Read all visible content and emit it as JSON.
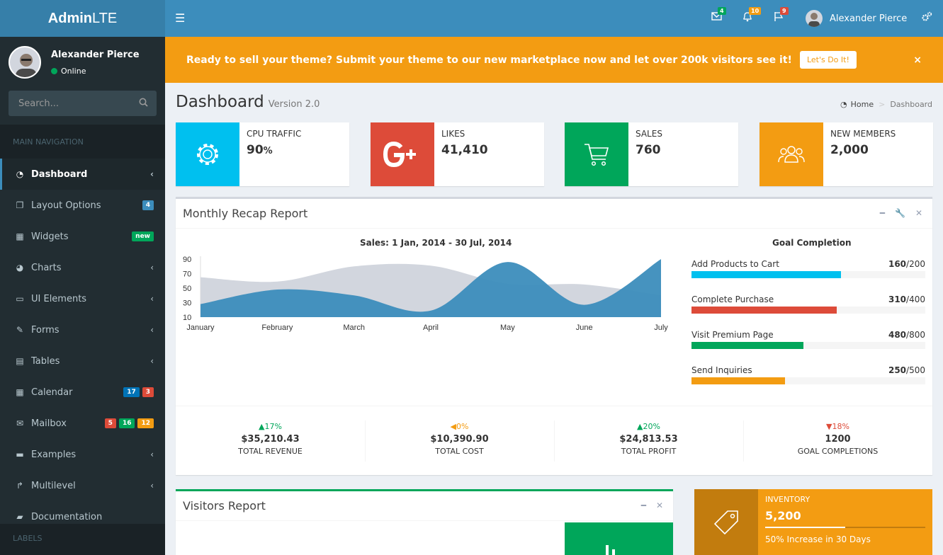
{
  "brand": {
    "name_bold": "Admin",
    "name_rest": "LTE"
  },
  "user": {
    "name": "Alexander Pierce",
    "status": "Online"
  },
  "search": {
    "placeholder": "Search..."
  },
  "sidebar": {
    "header": "MAIN NAVIGATION",
    "labels_header": "LABELS",
    "items": [
      {
        "label": "Dashboard",
        "icon": "dashboard-icon"
      },
      {
        "label": "Layout Options",
        "icon": "files-icon",
        "badges": [
          "4"
        ]
      },
      {
        "label": "Widgets",
        "icon": "grid-icon",
        "badges": [
          "new"
        ]
      },
      {
        "label": "Charts",
        "icon": "pie-chart-icon"
      },
      {
        "label": "UI Elements",
        "icon": "laptop-icon"
      },
      {
        "label": "Forms",
        "icon": "edit-icon"
      },
      {
        "label": "Tables",
        "icon": "table-icon"
      },
      {
        "label": "Calendar",
        "icon": "calendar-icon",
        "badges": [
          "17",
          "3"
        ]
      },
      {
        "label": "Mailbox",
        "icon": "envelope-icon",
        "badges": [
          "5",
          "16",
          "12"
        ]
      },
      {
        "label": "Examples",
        "icon": "folder-icon"
      },
      {
        "label": "Multilevel",
        "icon": "share-icon"
      },
      {
        "label": "Documentation",
        "icon": "book-icon"
      }
    ]
  },
  "topbar": {
    "messages_count": "4",
    "notifications_count": "10",
    "tasks_count": "9",
    "user_name": "Alexander Pierce"
  },
  "banner": {
    "text": "Ready to sell your theme? Submit your theme to our new marketplace now and let over 200k visitors see it!",
    "button": "Let's Do It!",
    "close": "×"
  },
  "page": {
    "title": "Dashboard",
    "subtitle": "Version 2.0"
  },
  "breadcrumb": {
    "home": "Home",
    "current": "Dashboard"
  },
  "info_boxes": [
    {
      "label": "CPU TRAFFIC",
      "value": "90",
      "unit": "%",
      "color": "#00c0ef",
      "icon": "gear-icon"
    },
    {
      "label": "LIKES",
      "value": "41,410",
      "color": "#dd4b39",
      "icon": "google-plus-icon"
    },
    {
      "label": "SALES",
      "value": "760",
      "color": "#00a65a",
      "icon": "shopping-cart-icon"
    },
    {
      "label": "NEW MEMBERS",
      "value": "2,000",
      "color": "#f39c12",
      "icon": "users-icon"
    }
  ],
  "recap": {
    "title": "Monthly Recap Report",
    "goal_title": "Goal Completion",
    "goals": [
      {
        "label": "Add Products to Cart",
        "done": "160",
        "total": "/200",
        "fraction": 0.8,
        "color": "#00c0ef"
      },
      {
        "label": "Complete Purchase",
        "done": "310",
        "total": "/400",
        "fraction": 0.775,
        "color": "#dd4b39"
      },
      {
        "label": "Visit Premium Page",
        "done": "480",
        "total": "/800",
        "fraction": 0.6,
        "color": "#00a65a"
      },
      {
        "label": "Send Inquiries",
        "done": "250",
        "total": "/500",
        "fraction": 0.5,
        "color": "#f39c12"
      }
    ],
    "stats": [
      {
        "pct": "17%",
        "dir": "up",
        "amount": "$35,210.43",
        "label": "TOTAL REVENUE"
      },
      {
        "pct": "0%",
        "dir": "flat",
        "amount": "$10,390.90",
        "label": "TOTAL COST"
      },
      {
        "pct": "20%",
        "dir": "up",
        "amount": "$24,813.53",
        "label": "TOTAL PROFIT"
      },
      {
        "pct": "18%",
        "dir": "down",
        "amount": "1200",
        "label": "GOAL COMPLETIONS"
      }
    ]
  },
  "chart_data": {
    "type": "area",
    "title": "Sales: 1 Jan, 2014 - 30 Jul, 2014",
    "categories": [
      "January",
      "February",
      "March",
      "April",
      "May",
      "June",
      "July"
    ],
    "ylim": [
      10,
      90
    ],
    "yticks": [
      10,
      30,
      50,
      70,
      90
    ],
    "series": [
      {
        "values": [
          65,
          59,
          80,
          81,
          56,
          55,
          40
        ],
        "color": "#d2d6de"
      },
      {
        "values": [
          28,
          48,
          40,
          19,
          86,
          27,
          90
        ],
        "color": "#3c8dbc"
      }
    ],
    "grid": false
  },
  "visitors": {
    "title": "Visitors Report"
  },
  "inventory": {
    "label": "INVENTORY",
    "value": "5,200",
    "progress": 0.5,
    "desc": "50% Increase in 30 Days",
    "icon": "tag-icon"
  }
}
